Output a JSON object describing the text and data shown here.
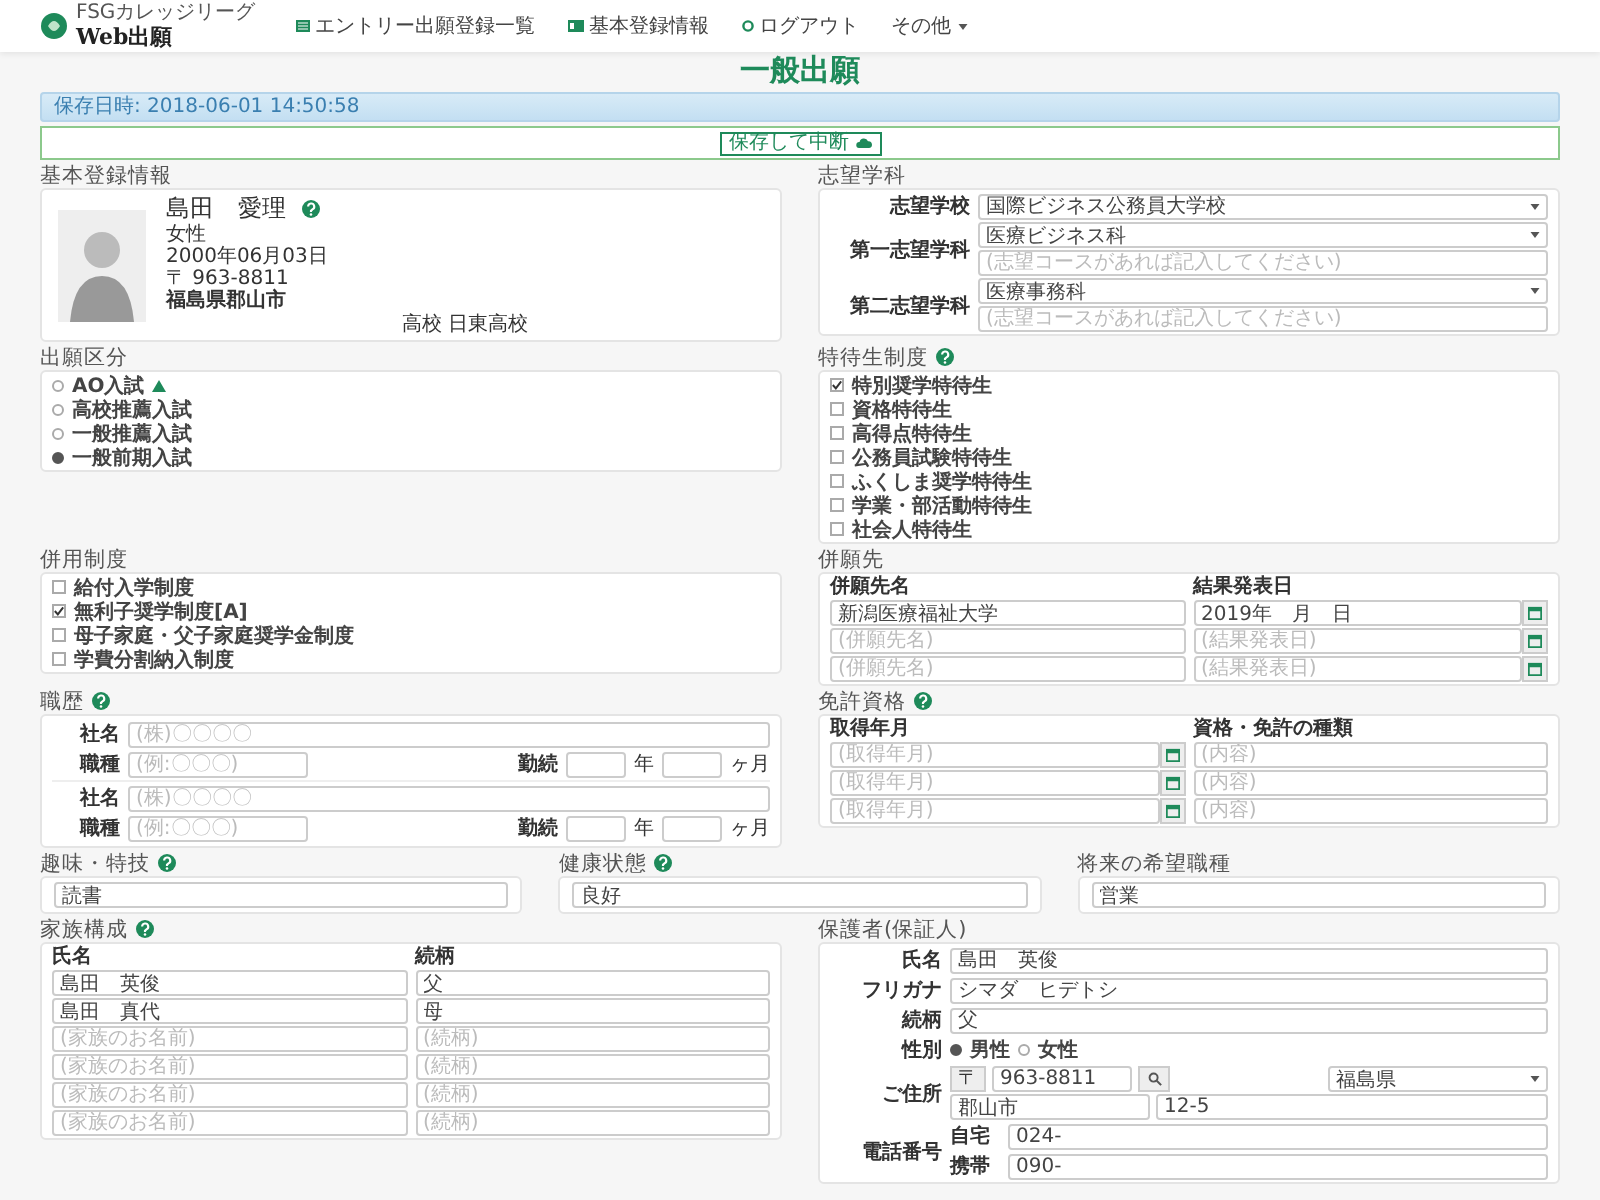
{
  "header": {
    "logo_tagline": "FSGカレッジリーグ",
    "logo_title": "Web出願",
    "nav": [
      {
        "label": "エントリー出願登録一覧",
        "kind": "list"
      },
      {
        "label": "基本登録情報",
        "kind": "card"
      },
      {
        "label": "ログアウト",
        "kind": "ring"
      },
      {
        "label": "その他",
        "kind": "menu"
      }
    ]
  },
  "page_title": "一般出願",
  "saved_notice": "保存日時: 2018-06-01 14:50:58",
  "save_button": "保存して中断",
  "basic_info": {
    "heading": "基本登録情報",
    "name": "島田　愛理",
    "help": true,
    "gender": "女性",
    "birthdate": "2000年06月03日",
    "postal": "〒 963-8811",
    "address": "福島県郡山市",
    "school": "高校 日東高校"
  },
  "preferences": {
    "heading": "志望学科",
    "rows": [
      {
        "label": "志望学校",
        "value": "国際ビジネス公務員大学校"
      },
      {
        "label": "第一志望学科",
        "value": "医療ビジネス科",
        "placeholder": "(志望コースがあれば記入してください)"
      },
      {
        "label": "第二志望学科",
        "value": "医療事務科",
        "placeholder": "(志望コースがあれば記入してください)"
      }
    ]
  },
  "application_type": {
    "heading": "出願区分",
    "options": [
      {
        "label": "AO入試",
        "selected": false,
        "flag": true
      },
      {
        "label": "高校推薦入試",
        "selected": false,
        "flag": false
      },
      {
        "label": "一般推薦入試",
        "selected": false,
        "flag": false
      },
      {
        "label": "一般前期入試",
        "selected": true,
        "flag": false
      }
    ]
  },
  "scholarships": {
    "heading": "特待生制度",
    "help": true,
    "options": [
      {
        "label": "特別奨学特待生",
        "checked": true
      },
      {
        "label": "資格特待生",
        "checked": false
      },
      {
        "label": "高得点特待生",
        "checked": false
      },
      {
        "label": "公務員試験特待生",
        "checked": false
      },
      {
        "label": "ふくしま奨学特待生",
        "checked": false
      },
      {
        "label": "学業・部活動特待生",
        "checked": false
      },
      {
        "label": "社会人特待生",
        "checked": false
      }
    ]
  },
  "combined_programs": {
    "heading": "併用制度",
    "options": [
      {
        "label": "給付入学制度",
        "checked": false
      },
      {
        "label": "無利子奨学制度[A]",
        "checked": true
      },
      {
        "label": "母子家庭・父子家庭奨学金制度",
        "checked": false
      },
      {
        "label": "学費分割納入制度",
        "checked": false
      }
    ]
  },
  "other_applications": {
    "heading": "併願先",
    "columns": [
      "併願先名",
      "結果発表日"
    ],
    "rows": [
      {
        "name": {
          "value": "新潟医療福祉大学"
        },
        "date": {
          "value": "2019年　月　日"
        }
      },
      {
        "name": {
          "placeholder": "(併願先名)"
        },
        "date": {
          "placeholder": "(結果発表日)"
        }
      },
      {
        "name": {
          "placeholder": "(併願先名)"
        },
        "date": {
          "placeholder": "(結果発表日)"
        }
      }
    ]
  },
  "work_history": {
    "heading": "職歴",
    "help": true,
    "entries": [
      {
        "company_label": "社名",
        "company_placeholder": "(株)〇〇〇〇",
        "job_label": "職種",
        "job_placeholder": "(例:〇〇〇)",
        "tenure_label": "勤続",
        "years_unit": "年",
        "months_unit": "ヶ月"
      },
      {
        "company_label": "社名",
        "company_placeholder": "(株)〇〇〇〇",
        "job_label": "職種",
        "job_placeholder": "(例:〇〇〇)",
        "tenure_label": "勤続",
        "years_unit": "年",
        "months_unit": "ヶ月"
      }
    ]
  },
  "licenses": {
    "heading": "免許資格",
    "help": true,
    "columns": [
      "取得年月",
      "資格・免許の種類"
    ],
    "rows": [
      {
        "date": {
          "placeholder": "(取得年月)"
        },
        "type": {
          "placeholder": "(内容)"
        }
      },
      {
        "date": {
          "placeholder": "(取得年月)"
        },
        "type": {
          "placeholder": "(内容)"
        }
      },
      {
        "date": {
          "placeholder": "(取得年月)"
        },
        "type": {
          "placeholder": "(内容)"
        }
      }
    ]
  },
  "personal": [
    {
      "heading": "趣味・特技",
      "help": true,
      "value": "読書"
    },
    {
      "heading": "健康状態",
      "help": true,
      "value": "良好"
    },
    {
      "heading": "将来の希望職種",
      "help": false,
      "value": "営業"
    }
  ],
  "family": {
    "heading": "家族構成",
    "help": true,
    "columns": [
      "氏名",
      "続柄"
    ],
    "rows": [
      {
        "name": {
          "value": "島田　英俊"
        },
        "relation": {
          "value": "父"
        }
      },
      {
        "name": {
          "value": "島田　真代"
        },
        "relation": {
          "value": "母"
        }
      },
      {
        "name": {
          "placeholder": "(家族のお名前)"
        },
        "relation": {
          "placeholder": "(続柄)"
        }
      },
      {
        "name": {
          "placeholder": "(家族のお名前)"
        },
        "relation": {
          "placeholder": "(続柄)"
        }
      },
      {
        "name": {
          "placeholder": "(家族のお名前)"
        },
        "relation": {
          "placeholder": "(続柄)"
        }
      },
      {
        "name": {
          "placeholder": "(家族のお名前)"
        },
        "relation": {
          "placeholder": "(続柄)"
        }
      }
    ]
  },
  "guardian": {
    "heading": "保護者(保証人)",
    "name_label": "氏名",
    "name": "島田　英俊",
    "kana_label": "フリガナ",
    "kana": "シマダ　ヒデトシ",
    "relation_label": "続柄",
    "relation": "父",
    "gender_label": "性別",
    "genders": [
      {
        "label": "男性",
        "selected": true
      },
      {
        "label": "女性",
        "selected": false
      }
    ],
    "address_label": "ご住所",
    "postal_mark": "〒",
    "postal": "963-8811",
    "prefecture": "福島県",
    "city": "郡山市",
    "street": "12-5",
    "phone_label": "電話番号",
    "phones": [
      {
        "label": "自宅",
        "value": "024-"
      },
      {
        "label": "携帯",
        "value": "090-"
      }
    ]
  }
}
